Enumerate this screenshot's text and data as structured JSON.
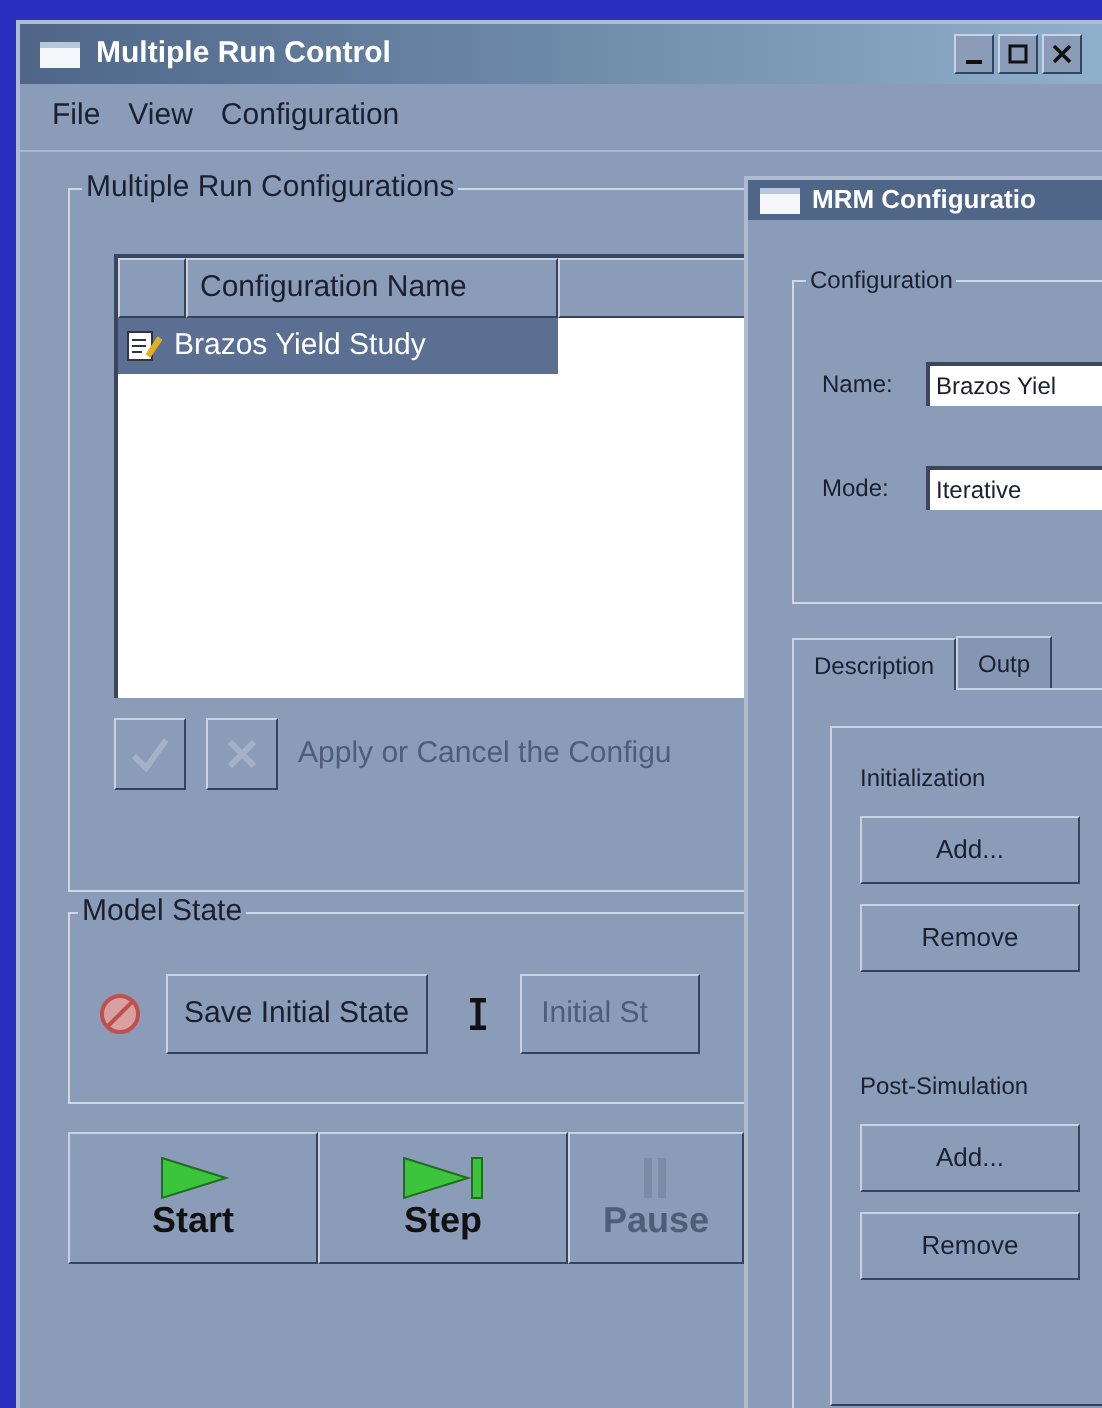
{
  "main_window": {
    "title": "Multiple Run Control",
    "menu": [
      "File",
      "View",
      "Configuration"
    ],
    "configurations_group": {
      "title": "Multiple Run Configurations",
      "columns": [
        "Configuration Name"
      ],
      "rows": [
        {
          "name": "Brazos Yield Study",
          "selected": true
        }
      ],
      "apply_buttons": [
        {
          "kind": "apply",
          "disabled": true
        },
        {
          "kind": "cancel",
          "disabled": true
        }
      ],
      "apply_text": "Apply or Cancel the Configu"
    },
    "model_state_group": {
      "title": "Model State",
      "save_button": "Save Initial State",
      "initial_button": "Initial St"
    },
    "run_buttons": [
      {
        "kind": "start",
        "label": "Start",
        "disabled": false
      },
      {
        "kind": "step",
        "label": "Step",
        "disabled": false
      },
      {
        "kind": "pause",
        "label": "Pause",
        "disabled": true
      }
    ]
  },
  "dialog": {
    "title": "MRM Configuratio",
    "group_title": "Configuration",
    "fields": [
      {
        "label": "Name:",
        "value": "Brazos Yiel"
      },
      {
        "label": "Mode:",
        "value": "Iterative"
      }
    ],
    "tabs": [
      {
        "label": "Description",
        "selected": true
      },
      {
        "label": "Outp",
        "selected": false
      }
    ],
    "sections": [
      {
        "title": "Initialization",
        "buttons": [
          "Add...",
          "Remove"
        ]
      },
      {
        "title": "Post-Simulation",
        "buttons": [
          "Add...",
          "Remove"
        ]
      }
    ]
  }
}
